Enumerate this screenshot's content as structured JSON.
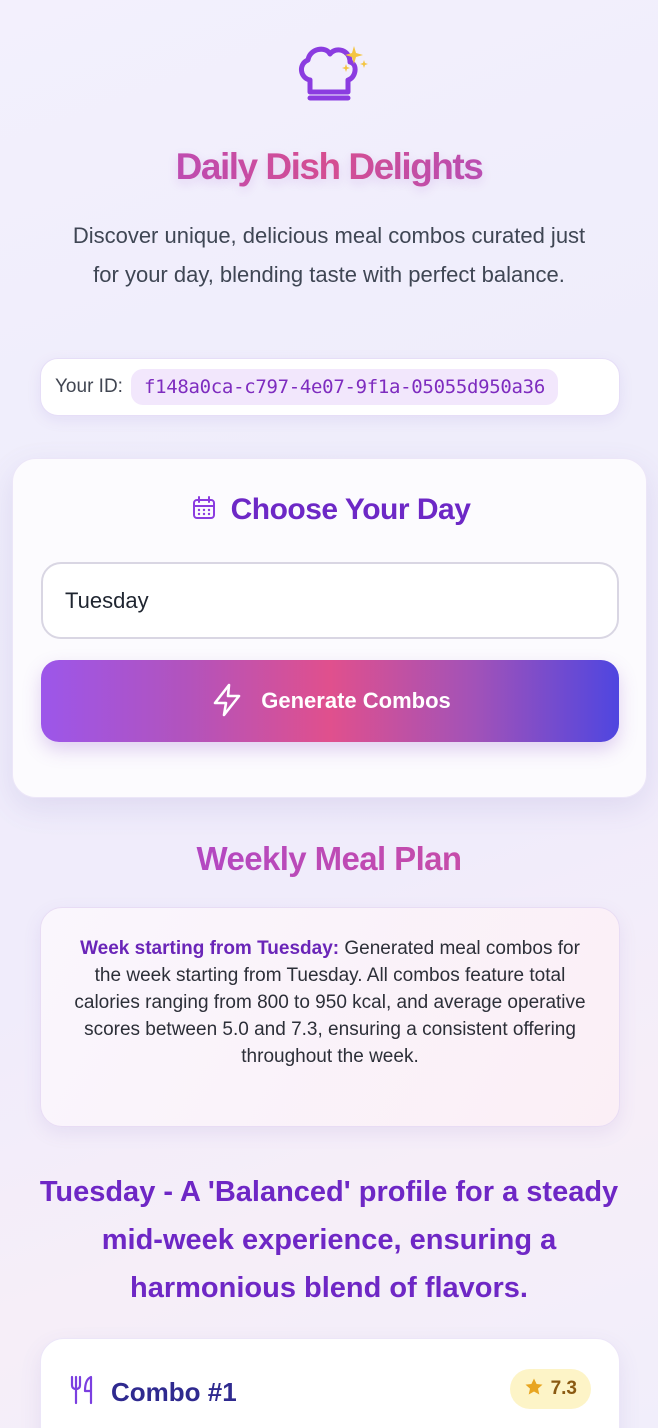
{
  "header": {
    "logo_icon": "chef-hat-sparkle-icon",
    "title": "Daily Dish Delights",
    "subtitle": "Discover unique, delicious meal combos curated just for your day, blending taste with perfect balance."
  },
  "user": {
    "id_label": "Your ID:",
    "id_value": "f148a0ca-c797-4e07-9f1a-05055d950a36"
  },
  "day_selector": {
    "icon": "calendar-icon",
    "title": "Choose Your Day",
    "input_value": "Tuesday",
    "button_icon": "lightning-icon",
    "button_label": "Generate Combos"
  },
  "plan": {
    "title": "Weekly Meal Plan",
    "summary_label": "Week starting from Tuesday:",
    "summary_text": " Generated meal combos for the week starting from Tuesday. All combos feature total calories ranging from 800 to 950 kcal, and average operative scores between 5.0 and 7.3, ensuring a consistent offering throughout the week.",
    "day_profile": "Tuesday - A 'Balanced' profile for a steady mid-week experience, ensuring a harmonious blend of flavors."
  },
  "combos": [
    {
      "icon": "utensils-icon",
      "title": "Combo #1",
      "score_icon": "star-icon",
      "score": "7.3"
    }
  ],
  "colors": {
    "accent_purple": "#6d28c6",
    "title_gradient_start": "#a54ad6",
    "title_gradient_mid": "#d94f8f",
    "button_gradient_end": "#4f46e0",
    "score_badge_bg": "#fdf4c7"
  }
}
